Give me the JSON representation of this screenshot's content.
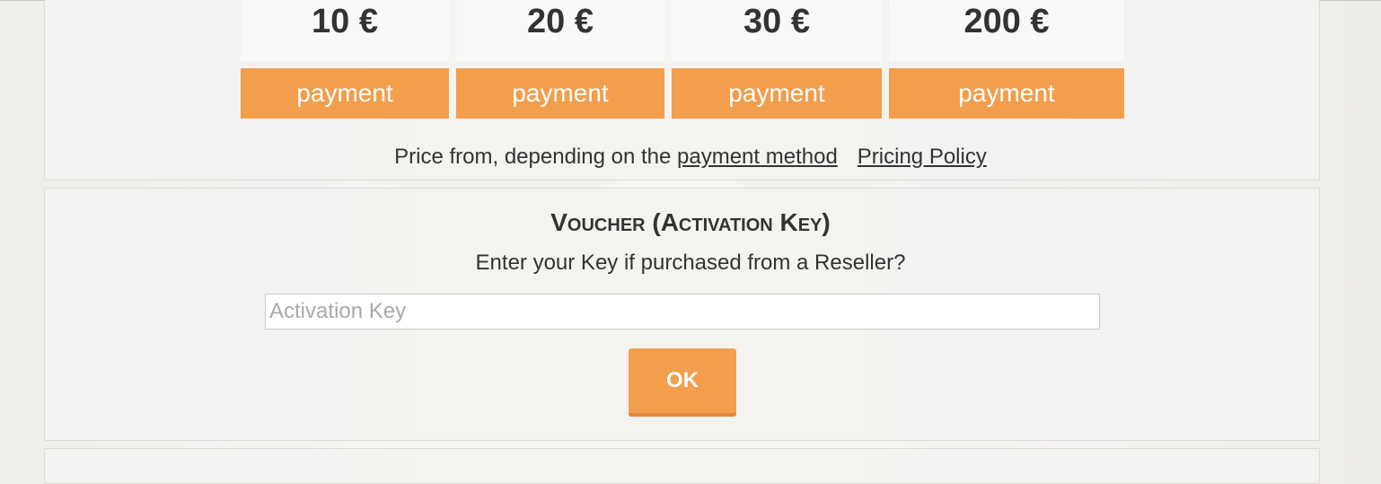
{
  "pricing": {
    "options": [
      {
        "price": "10 €",
        "button_label": "payment"
      },
      {
        "price": "20 €",
        "button_label": "payment"
      },
      {
        "price": "30 €",
        "button_label": "payment"
      },
      {
        "price": "200 €",
        "button_label": "payment"
      }
    ],
    "note_text": "Price from, depending on the",
    "payment_method_link": "payment method",
    "pricing_policy_link": "Pricing Policy"
  },
  "voucher": {
    "title": "Voucher (Activation Key)",
    "subtitle": "Enter your Key if purchased from a Reseller?",
    "input_placeholder": "Activation Key",
    "input_value": "",
    "ok_label": "OK"
  },
  "colors": {
    "accent": "#f29e4c",
    "text": "#333333",
    "price_box_bg": "#f9f9f9"
  }
}
